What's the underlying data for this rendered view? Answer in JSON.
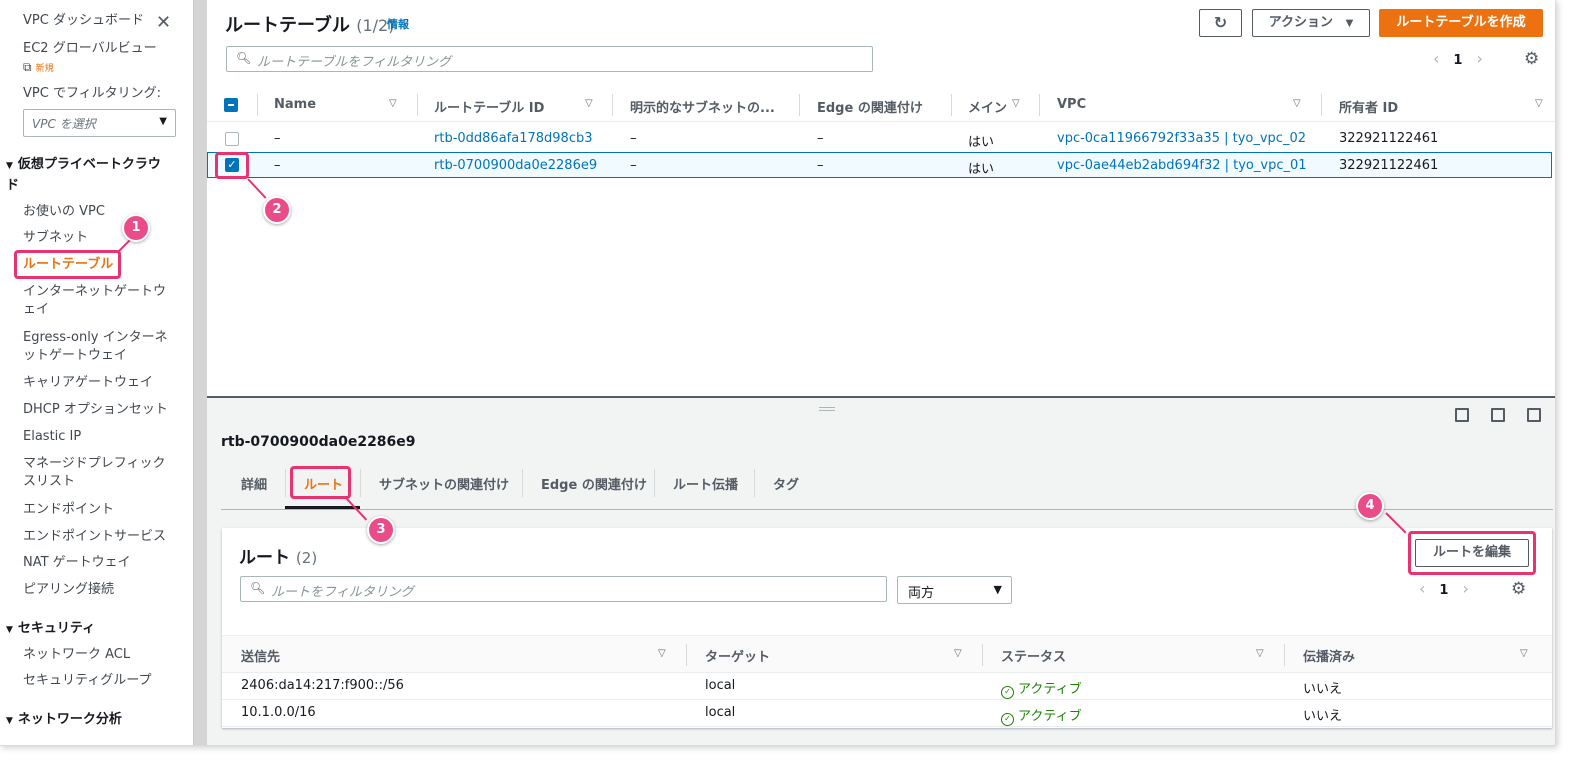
{
  "sidebar": {
    "dashboard": "VPC ダッシュボード",
    "ec2_global_view": "EC2 グローバルビュー",
    "new_badge": "新規",
    "filter_label": "VPC でフィルタリング:",
    "vpc_select_placeholder": "VPC を選択",
    "section_private_cloud": "仮想プライベートクラウド",
    "items_private_cloud": [
      "お使いの VPC",
      "サブネット",
      "ルートテーブル",
      "インターネットゲートウェイ",
      "Egress-only インターネットゲートウェイ",
      "キャリアゲートウェイ",
      "DHCP オプションセット",
      "Elastic IP",
      "マネージドプレフィックスリスト",
      "エンドポイント",
      "エンドポイントサービス",
      "NAT ゲートウェイ",
      "ピアリング接続"
    ],
    "section_security": "セキュリティ",
    "items_security": [
      "ネットワーク ACL",
      "セキュリティグループ"
    ],
    "section_network_analysis": "ネットワーク分析"
  },
  "header": {
    "title": "ルートテーブル",
    "count": "(1/2)",
    "info": "情報",
    "actions_label": "アクション",
    "create_label": "ルートテーブルを作成",
    "filter_placeholder": "ルートテーブルをフィルタリング",
    "page": "1"
  },
  "table": {
    "columns": [
      "Name",
      "ルートテーブル ID",
      "明示的なサブネットの...",
      "Edge の関連付け",
      "メイン",
      "VPC",
      "所有者 ID"
    ],
    "rows": [
      {
        "name": "–",
        "id": "rtb-0dd86afa178d98cb3",
        "subnet": "–",
        "edge": "–",
        "main": "はい",
        "vpc": "vpc-0ca11966792f33a35 | tyo_vpc_02",
        "owner": "322921122461",
        "selected": false
      },
      {
        "name": "–",
        "id": "rtb-0700900da0e2286e9",
        "subnet": "–",
        "edge": "–",
        "main": "はい",
        "vpc": "vpc-0ae44eb2abd694f32 | tyo_vpc_01",
        "owner": "322921122461",
        "selected": true
      }
    ]
  },
  "detail": {
    "title": "rtb-0700900da0e2286e9",
    "tabs": [
      "詳細",
      "ルート",
      "サブネットの関連付け",
      "Edge の関連付け",
      "ルート伝播",
      "タグ"
    ],
    "active_tab": "ルート"
  },
  "routes": {
    "title": "ルート",
    "count": "(2)",
    "edit_label": "ルートを編集",
    "filter_placeholder": "ルートをフィルタリング",
    "scope_select": "両方",
    "page": "1",
    "columns": [
      "送信先",
      "ターゲット",
      "ステータス",
      "伝播済み"
    ],
    "rows": [
      {
        "destination": "2406:da14:217:f900::/56",
        "target": "local",
        "status": "アクティブ",
        "propagated": "いいえ"
      },
      {
        "destination": "10.1.0.0/16",
        "target": "local",
        "status": "アクティブ",
        "propagated": "いいえ"
      }
    ]
  },
  "annotations": [
    "1",
    "2",
    "3",
    "4"
  ],
  "colors": {
    "accent": "#ec7211",
    "link": "#0073bb",
    "highlight": "#e8336f",
    "status_ok": "#1d8102"
  }
}
